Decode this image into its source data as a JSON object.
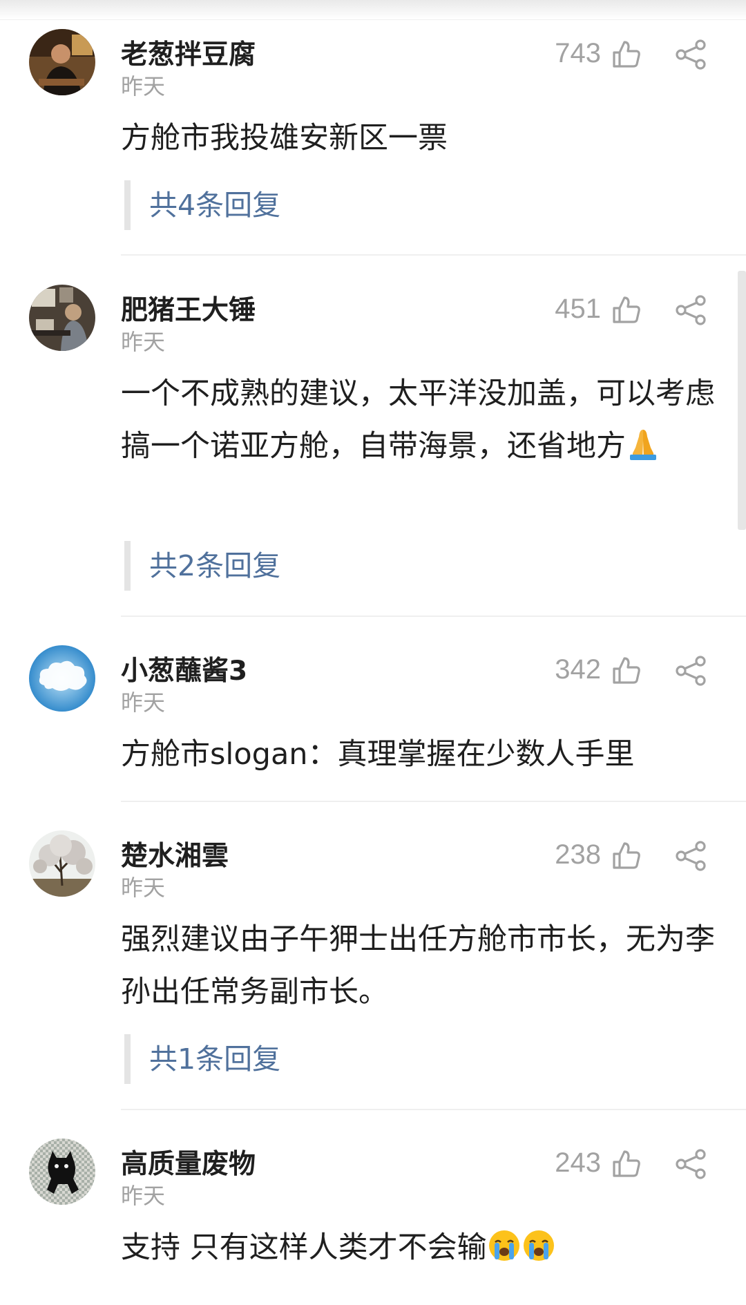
{
  "comments": [
    {
      "user": "老葱拌豆腐",
      "time": "昨天",
      "likes": "743",
      "avatar_icon": "person-photo-avatar",
      "text": "方舱市我投雄安新区一票",
      "emoji": [],
      "replies": "共4条回复"
    },
    {
      "user": "肥猪王大锤",
      "time": "昨天",
      "likes": "451",
      "avatar_icon": "person-at-desk-avatar",
      "text": "一个不成熟的建议，太平洋没加盖，可以考虑搞一个诺亚方舱，自带海景，还省地方",
      "emoji": [
        "folded-hands-emoji"
      ],
      "replies": "共2条回复"
    },
    {
      "user": "小葱蘸酱3",
      "time": "昨天",
      "likes": "342",
      "avatar_icon": "cloud-sky-avatar",
      "text": "方舱市slogan：真理掌握在少数人手里",
      "emoji": [],
      "replies": ""
    },
    {
      "user": "楚水湘雲",
      "time": "昨天",
      "likes": "238",
      "avatar_icon": "blossom-tree-avatar",
      "text": "强烈建议由子午狎士出任方舱市市长，无为李孙出任常务副市长。",
      "emoji": [],
      "replies": "共1条回复"
    },
    {
      "user": "高质量废物",
      "time": "昨天",
      "likes": "243",
      "avatar_icon": "black-cat-avatar",
      "text": "支持 只有这样人类才不会输",
      "emoji": [
        "loudly-crying-face-emoji",
        "loudly-crying-face-emoji"
      ],
      "replies": ""
    }
  ],
  "colors": {
    "username": "#1f1f1f",
    "meta_gray": "#a2a2a2",
    "reply_link": "#50719c",
    "reply_bar": "#e4e4e4",
    "divider": "#efefef"
  }
}
